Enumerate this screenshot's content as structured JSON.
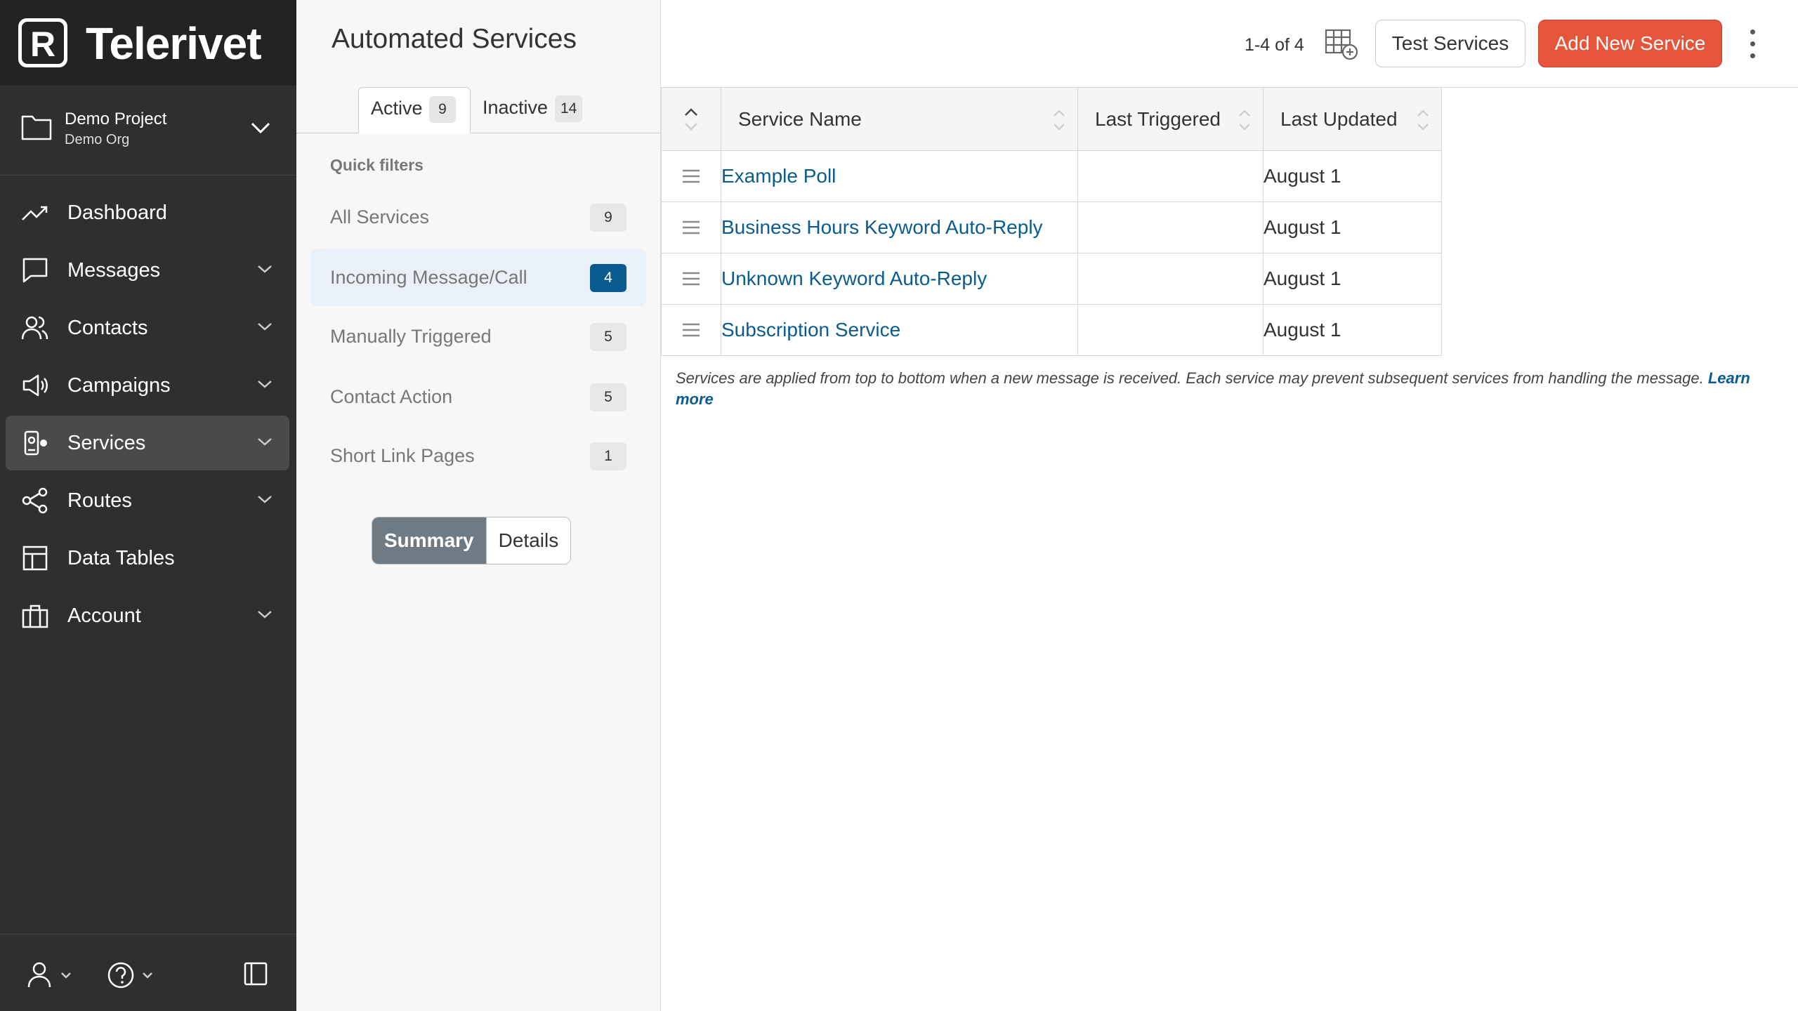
{
  "app": {
    "brand": "Telerivet",
    "accent": "#e4553c",
    "link_color": "#0b5c8e"
  },
  "project": {
    "name": "Demo Project",
    "org": "Demo Org"
  },
  "sidebar": {
    "items": [
      {
        "label": "Dashboard",
        "icon": "trend-icon",
        "has_children": false
      },
      {
        "label": "Messages",
        "icon": "message-icon",
        "has_children": true
      },
      {
        "label": "Contacts",
        "icon": "users-icon",
        "has_children": true
      },
      {
        "label": "Campaigns",
        "icon": "megaphone-icon",
        "has_children": true
      },
      {
        "label": "Services",
        "icon": "robot-icon",
        "has_children": true,
        "active": true
      },
      {
        "label": "Routes",
        "icon": "share-icon",
        "has_children": true
      },
      {
        "label": "Data Tables",
        "icon": "table-icon",
        "has_children": false
      },
      {
        "label": "Account",
        "icon": "briefcase-icon",
        "has_children": true
      }
    ]
  },
  "page": {
    "title": "Automated Services",
    "range": "1-4 of 4"
  },
  "tabs": [
    {
      "label": "Active",
      "count": "9"
    },
    {
      "label": "Inactive",
      "count": "14"
    }
  ],
  "quick_filters": {
    "heading": "Quick filters",
    "items": [
      {
        "label": "All Services",
        "count": "9"
      },
      {
        "label": "Incoming Message/Call",
        "count": "4",
        "active": true
      },
      {
        "label": "Manually Triggered",
        "count": "5"
      },
      {
        "label": "Contact Action",
        "count": "5"
      },
      {
        "label": "Short Link Pages",
        "count": "1"
      }
    ]
  },
  "view_toggle": {
    "summary": "Summary",
    "details": "Details",
    "selected": "Summary"
  },
  "actions": {
    "test": "Test Services",
    "add": "Add New Service"
  },
  "table": {
    "columns": [
      "Service Name",
      "Last Triggered",
      "Last Updated"
    ],
    "rows": [
      {
        "name": "Example Poll",
        "last_triggered": "",
        "last_updated": "August 1"
      },
      {
        "name": "Business Hours Keyword Auto-Reply",
        "last_triggered": "",
        "last_updated": "August 1"
      },
      {
        "name": "Unknown Keyword Auto-Reply",
        "last_triggered": "",
        "last_updated": "August 1"
      },
      {
        "name": "Subscription Service",
        "last_triggered": "",
        "last_updated": "August 1"
      }
    ]
  },
  "note": {
    "text": "Services are applied from top to bottom when a new message is received. Each service may prevent subsequent services from handling the message. ",
    "link": "Learn more"
  }
}
